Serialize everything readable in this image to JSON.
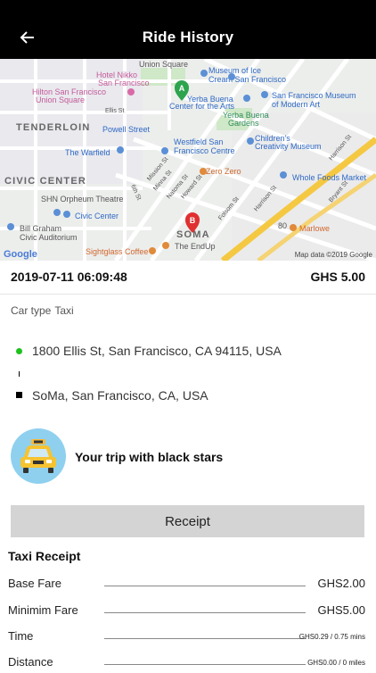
{
  "header": {
    "title": "Ride History",
    "back_icon": "arrow-left-icon"
  },
  "map": {
    "labels": {
      "union_square": "Union Square",
      "hotel_nikko": "Hotel Nikko",
      "san_francisco_1": "San Francisco",
      "hilton": "Hilton San Francisco",
      "union_square_2": "Union Square",
      "museum_ice_cream": "Museum of Ice",
      "museum_ice_cream_2": "Cream San Francisco",
      "yerba_buena_center": "Yerba Buena",
      "yerba_buena_center_2": "Center for the Arts",
      "sfmoma": "San Francisco Museum",
      "sfmoma_2": "of Modern Art",
      "tenderloin": "TENDERLOIN",
      "powell_street": "Powell Street",
      "yerba_buena_gardens": "Yerba Buena",
      "yerba_buena_gardens_2": "Gardens",
      "westfield": "Westfield San",
      "westfield_2": "Francisco Centre",
      "warfield": "The Warfield",
      "childrens": "Children's",
      "childrens_2": "Creativity Museum",
      "civic_center": "CIVIC CENTER",
      "zero_zero": "Zero Zero",
      "whole_foods": "Whole Foods Market",
      "orpheum": "SHN Orpheum Theatre",
      "civic_center_2": "Civic Center",
      "bill_graham": "Bill Graham",
      "bill_graham_2": "Civic Auditorium",
      "soma": "SOMA",
      "marlowe": "Marlowe",
      "endup": "The EndUp",
      "sightglass": "Sightglass Coffee",
      "mission_st": "Mission St",
      "howard_st": "Howard St",
      "natoma_st": "Natoma St",
      "folsom_st": "Folsom St",
      "harrison_st": "Harrison St",
      "bryant_st": "Bryant St",
      "sixth_st": "6th St",
      "ellis_st": "Ellis St",
      "minna_st": "Minna St",
      "harrison_st_2": "Harrison St",
      "freeway": "80",
      "pin_a": "A",
      "pin_b": "B"
    },
    "google_logo": "Google",
    "attribution": "Map data ©2019 Google"
  },
  "trip": {
    "datetime": "2019-07-11 06:09:48",
    "price": "GHS 5.00",
    "car_type_label": "Car type",
    "car_type_value": "Taxi",
    "pickup": "1800 Ellis St, San Francisco, CA 94115, USA",
    "dropoff": "SoMa, San Francisco, CA, USA",
    "driver_message": "Your trip with black stars"
  },
  "receipt": {
    "button_label": "Receipt",
    "title": "Taxi Receipt",
    "rows": [
      {
        "label": "Base Fare",
        "value": "GHS2.00"
      },
      {
        "label": "Minimim Fare",
        "value": "GHS5.00"
      },
      {
        "label": "Time",
        "value": "GHS0.29 / 0.75 mins"
      },
      {
        "label": "Distance",
        "value": "GHS0.00 / 0 miles"
      }
    ]
  },
  "colors": {
    "header_bg": "#000000",
    "pickup_dot": "#1ec21e",
    "dropoff_dot": "#000000",
    "receipt_button_bg": "#d4d4d4",
    "pin_a": "#2ea44f",
    "pin_b": "#e03030"
  }
}
